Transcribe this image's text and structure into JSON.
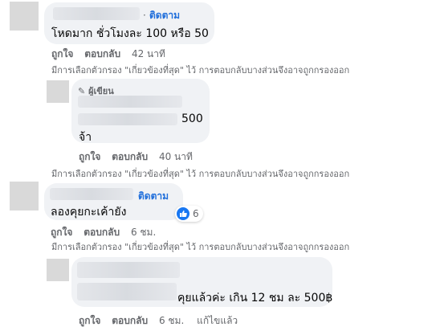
{
  "comments": [
    {
      "follow_prefix": "·",
      "follow_label": "ติดตาม",
      "text": "โหดมาก ชั่วโมงละ 100 หรือ 50",
      "actions": {
        "like": "ถูกใจ",
        "reply": "ตอบกลับ",
        "time": "42 นาที"
      },
      "filter_note": "มีการเลือกตัวกรอง \"เกี่ยวข้องที่สุด\" ไว้ การตอบกลับบางส่วนจึงอาจถูกกรองออก"
    },
    {
      "author_badge": "ผู้เขียน",
      "text_line1": "500",
      "text_line2": "จ้า",
      "actions": {
        "like": "ถูกใจ",
        "reply": "ตอบกลับ",
        "time": "40 นาที"
      },
      "filter_note": "มีการเลือกตัวกรอง \"เกี่ยวข้องที่สุด\" ไว้ การตอบกลับบางส่วนจึงอาจถูกกรองออก"
    },
    {
      "follow_label": "ติดตาม",
      "text": "ลองคุยกะเค้ายัง",
      "reaction_count": "6",
      "actions": {
        "like": "ถูกใจ",
        "reply": "ตอบกลับ",
        "time": "6 ชม."
      },
      "filter_note": "มีการเลือกตัวกรอง \"เกี่ยวข้องที่สุด\" ไว้ การตอบกลับบางส่วนจึงอาจถูกกรองออก"
    },
    {
      "text": "คุยแล้วค่ะ เกิน 12 ชม ละ 500฿",
      "actions": {
        "like": "ถูกใจ",
        "reply": "ตอบกลับ",
        "time": "6 ชม.",
        "edited": "แก้ไขแล้ว"
      }
    }
  ],
  "colors": {
    "link": "#216fdb",
    "bubble": "#f0f2f5",
    "meta": "#65676b",
    "like": "#1877f2"
  }
}
